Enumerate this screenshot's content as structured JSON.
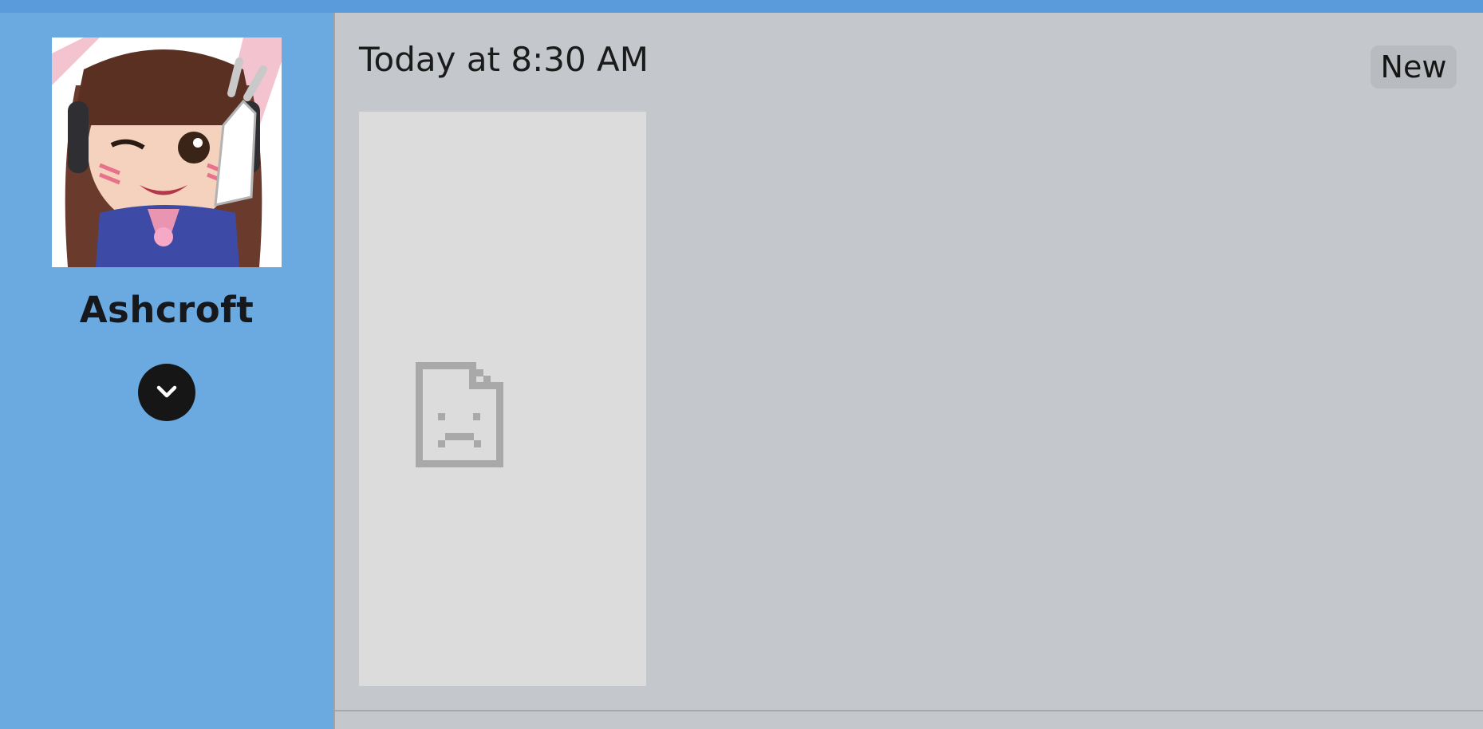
{
  "window": {
    "accent_color": "#5a9bdc",
    "sidebar_color": "#6aaae0",
    "content_color": "#c4c8cc"
  },
  "sidebar": {
    "avatar_alt": "user avatar",
    "username": "Ashcroft",
    "expand_icon": "chevron-down-icon"
  },
  "message": {
    "timestamp": "Today at 8:30 AM",
    "badge": "New",
    "attachment_icon": "broken-image-icon"
  }
}
